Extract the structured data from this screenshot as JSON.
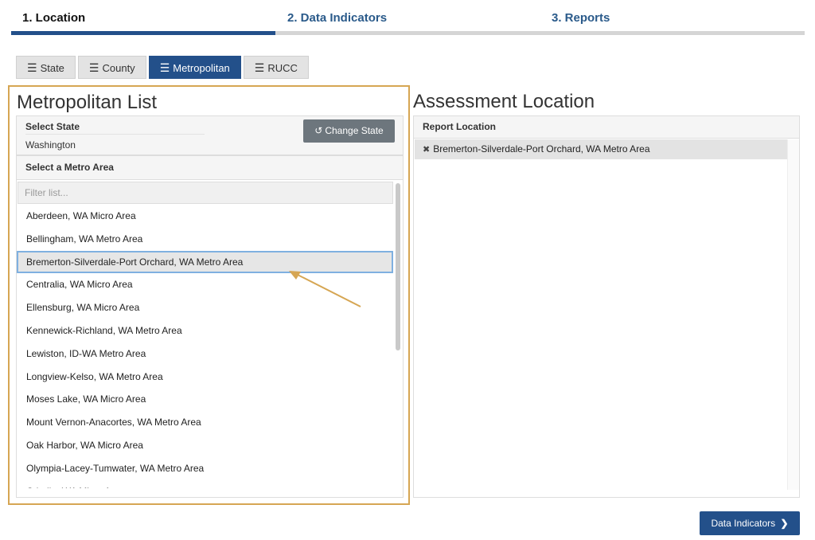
{
  "steps": [
    {
      "label": "1. Location"
    },
    {
      "label": "2. Data Indicators"
    },
    {
      "label": "3. Reports"
    }
  ],
  "tabs": [
    {
      "label": "State"
    },
    {
      "label": "County"
    },
    {
      "label": "Metropolitan"
    },
    {
      "label": "RUCC"
    }
  ],
  "left": {
    "title": "Metropolitan List",
    "select_state_label": "Select State",
    "state_value": "Washington",
    "change_state_label": "Change State",
    "metro_label": "Select a Metro Area",
    "filter_placeholder": "Filter list...",
    "items": [
      "Aberdeen, WA Micro Area",
      "Bellingham, WA Metro Area",
      "Bremerton-Silverdale-Port Orchard, WA Metro Area",
      "Centralia, WA Micro Area",
      "Ellensburg, WA Micro Area",
      "Kennewick-Richland, WA Metro Area",
      "Lewiston, ID-WA Metro Area",
      "Longview-Kelso, WA Metro Area",
      "Moses Lake, WA Micro Area",
      "Mount Vernon-Anacortes, WA Metro Area",
      "Oak Harbor, WA Micro Area",
      "Olympia-Lacey-Tumwater, WA Metro Area",
      "Othello, WA Micro Area"
    ],
    "selected_index": 2
  },
  "right": {
    "title": "Assessment Location",
    "report_label": "Report Location",
    "report_item": "Bremerton-Silverdale-Port Orchard, WA Metro Area"
  },
  "next_button_label": "Data Indicators",
  "colors": {
    "accent": "#23508a",
    "highlight_border": "#d6a653",
    "arrow": "#d6a653"
  }
}
